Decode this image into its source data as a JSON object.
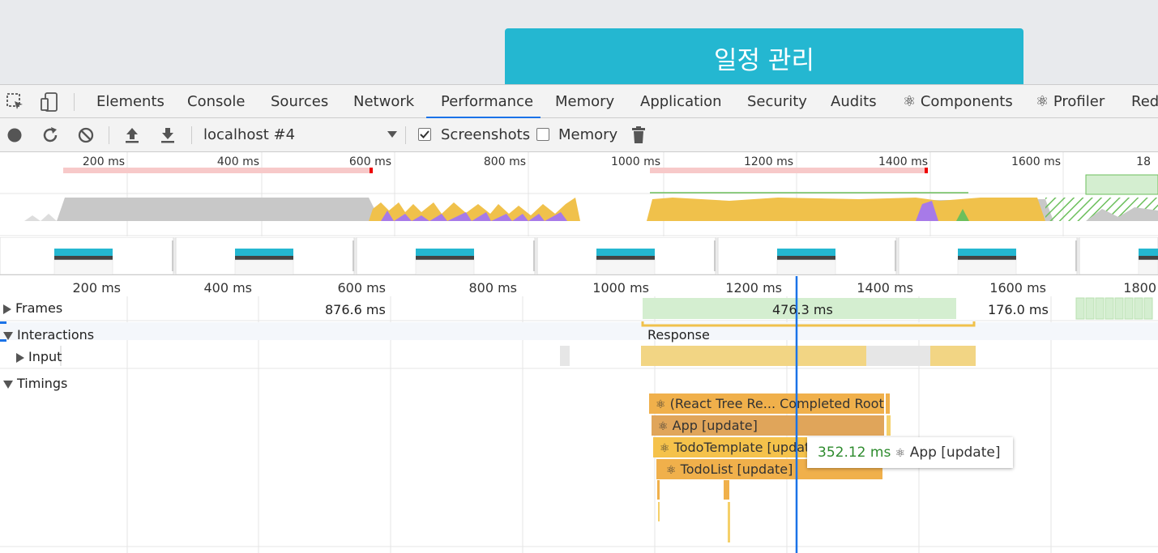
{
  "page": {
    "app_title": "일정 관리"
  },
  "tabs": [
    "Elements",
    "Console",
    "Sources",
    "Network",
    "Performance",
    "Memory",
    "Application",
    "Security",
    "Audits",
    "⚛ Components",
    "⚛ Profiler",
    "Redu"
  ],
  "active_tab": "Performance",
  "toolbar": {
    "target": "localhost #4",
    "screenshots_label": "Screenshots",
    "screenshots_checked": true,
    "memory_label": "Memory",
    "memory_checked": false
  },
  "overview_ticks": [
    "200 ms",
    "400 ms",
    "600 ms",
    "800 ms",
    "1000 ms",
    "1200 ms",
    "1400 ms",
    "1600 ms",
    "18"
  ],
  "main_ticks": [
    "200 ms",
    "400 ms",
    "600 ms",
    "800 ms",
    "1000 ms",
    "1200 ms",
    "1400 ms",
    "1600 ms",
    "1800"
  ],
  "tracks": {
    "frames": {
      "label": "Frames",
      "values": [
        "876.6 ms",
        "476.3 ms",
        "176.0 ms"
      ]
    },
    "interactions": {
      "label": "Interactions",
      "response": "Response"
    },
    "input": {
      "label": "Input"
    },
    "timings": {
      "label": "Timings"
    }
  },
  "timings": [
    {
      "icon": "⚛",
      "label": "(React Tree Re... Completed Root)"
    },
    {
      "icon": "⚛",
      "label": "App [update]"
    },
    {
      "icon": "⚛",
      "label": "TodoTemplate [update]"
    },
    {
      "icon": "⚛",
      "label": "TodoList [update]"
    }
  ],
  "tooltip": {
    "duration": "352.12 ms",
    "icon": "⚛",
    "label": "App [update]"
  },
  "colors": {
    "accent": "#1a73e8",
    "banner": "#24b7d1",
    "scripting": "#f0c14b",
    "rendering": "#a77ae8",
    "frames": "#d4eed0",
    "timing": "#f0b04b"
  }
}
